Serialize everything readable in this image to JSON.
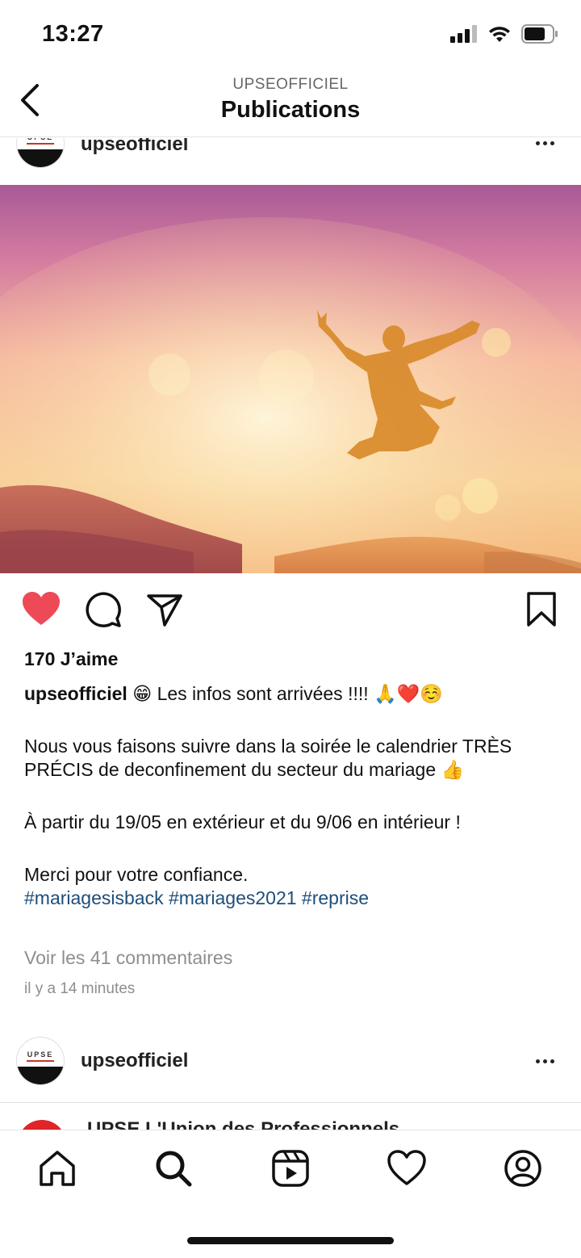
{
  "status": {
    "time": "13:27"
  },
  "header": {
    "subtitle": "UPSEOFFICIEL",
    "title": "Publications"
  },
  "post": {
    "username": "upseofficiel",
    "likes": "170 J’aime",
    "caption": {
      "user": "upseofficiel",
      "first": "😁 Les infos sont arrivées !!!! 🙏❤️☺️",
      "p1": "Nous vous faisons suivre dans la soirée le calendrier TRÈS PRÉCIS de deconfinement du secteur du mariage 👍",
      "p2": "À partir du 19/05 en extérieur et du 9/06 en intérieur !",
      "p3": "Merci pour votre confiance.",
      "hashtags": "#mariagesisback #mariages2021 #reprise"
    },
    "comments_link": "Voir les 41 commentaires",
    "time_ago": "il y a 14 minutes",
    "liked": true
  },
  "avatar_brand": "UPSE",
  "post2": {
    "username": "upseofficiel"
  },
  "next_post_peek": "UPSE L'Union des Professionnels",
  "icons": {
    "back": "chevron-left-icon",
    "like": "heart-filled-icon",
    "comment": "comment-icon",
    "share": "paper-plane-icon",
    "save": "bookmark-icon",
    "home": "home-icon",
    "search": "search-icon",
    "reels": "reels-icon",
    "activity": "heart-icon",
    "profile": "profile-icon"
  },
  "colors": {
    "like": "#ed4956",
    "hashtag": "#1e4e79",
    "muted": "#8e8e8e"
  }
}
